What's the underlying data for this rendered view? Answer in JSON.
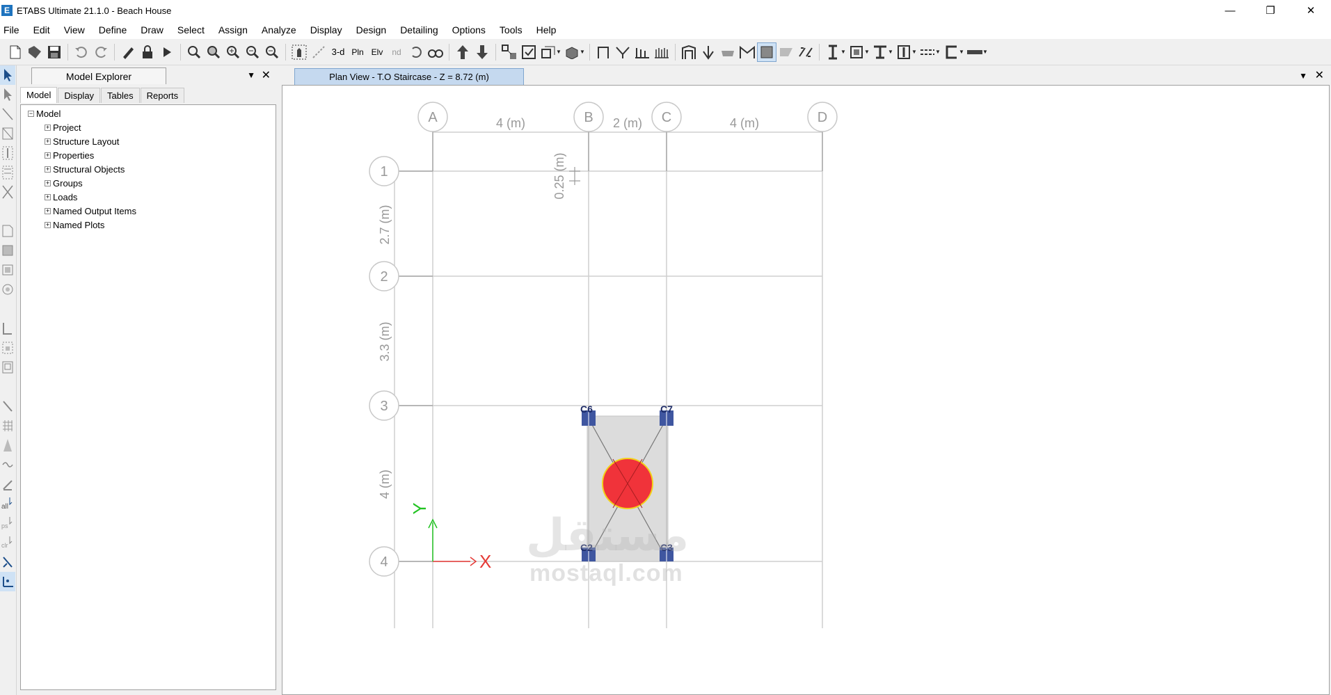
{
  "window": {
    "title": "ETABS Ultimate 21.1.0 - Beach House",
    "app_icon_letter": "E",
    "minimize": "—",
    "restore": "❐",
    "close": "✕"
  },
  "menu": [
    "File",
    "Edit",
    "View",
    "Define",
    "Draw",
    "Select",
    "Assign",
    "Analyze",
    "Display",
    "Design",
    "Detailing",
    "Options",
    "Tools",
    "Help"
  ],
  "toolbar": {
    "icons": [
      "new-model-icon",
      "open-icon",
      "save-icon",
      "undo-icon",
      "redo-icon",
      "refresh-icon",
      "lock-icon",
      "run-analysis-icon",
      "zoom-rubber-icon",
      "zoom-restore-icon",
      "zoom-in-icon",
      "zoom-out-icon",
      "zoom-previous-icon",
      "pan-icon",
      "3d-view-icon",
      "plan-view-icon",
      "elevation-view-icon",
      "2d-view-icon",
      "rotate-icon",
      "perspective-icon",
      "move-up-icon",
      "move-down-icon"
    ],
    "label_3d": "3-d",
    "label_pln": "Pln",
    "label_elv": "Elv",
    "label_2d": "nd"
  },
  "explorer": {
    "title": "Model Explorer",
    "pin": "▼",
    "close": "✕",
    "tabs": [
      "Model",
      "Display",
      "Tables",
      "Reports"
    ],
    "root": "Model",
    "items": [
      "Project",
      "Structure Layout",
      "Properties",
      "Structural Objects",
      "Groups",
      "Loads",
      "Named Output Items",
      "Named Plots"
    ]
  },
  "view": {
    "tab_title": "Plan View - T.O Staircase - Z = 8.72 (m)",
    "pin": "▼",
    "close": "✕"
  },
  "plan": {
    "grid_x": [
      {
        "label": "A"
      },
      {
        "label": "B"
      },
      {
        "label": "C"
      },
      {
        "label": "D"
      }
    ],
    "grid_y": [
      {
        "label": "1"
      },
      {
        "label": "2"
      },
      {
        "label": "3"
      },
      {
        "label": "4"
      }
    ],
    "x_spacings": [
      "4 (m)",
      "2 (m)",
      "4 (m)"
    ],
    "y_spacings": [
      "2.7 (m)",
      "3.3 (m)",
      "4 (m)"
    ],
    "offset_dimension": "0.25 (m)",
    "columns": [
      "C6",
      "C7",
      "C2",
      "C3"
    ],
    "axis_x_label": "X",
    "axis_y_label": "Y",
    "colors": {
      "grid_line": "#cfcfcf",
      "grid_bubble": "#c8c8c8",
      "column": "#3f56a0",
      "slab": "#dcdcdc",
      "load_circle": "#f0333a",
      "load_outline": "#f2d21b",
      "axis_x": "#e53935",
      "axis_y": "#22c322"
    }
  },
  "watermark": {
    "arabic": "مستقل",
    "latin": "mostaql.com"
  }
}
